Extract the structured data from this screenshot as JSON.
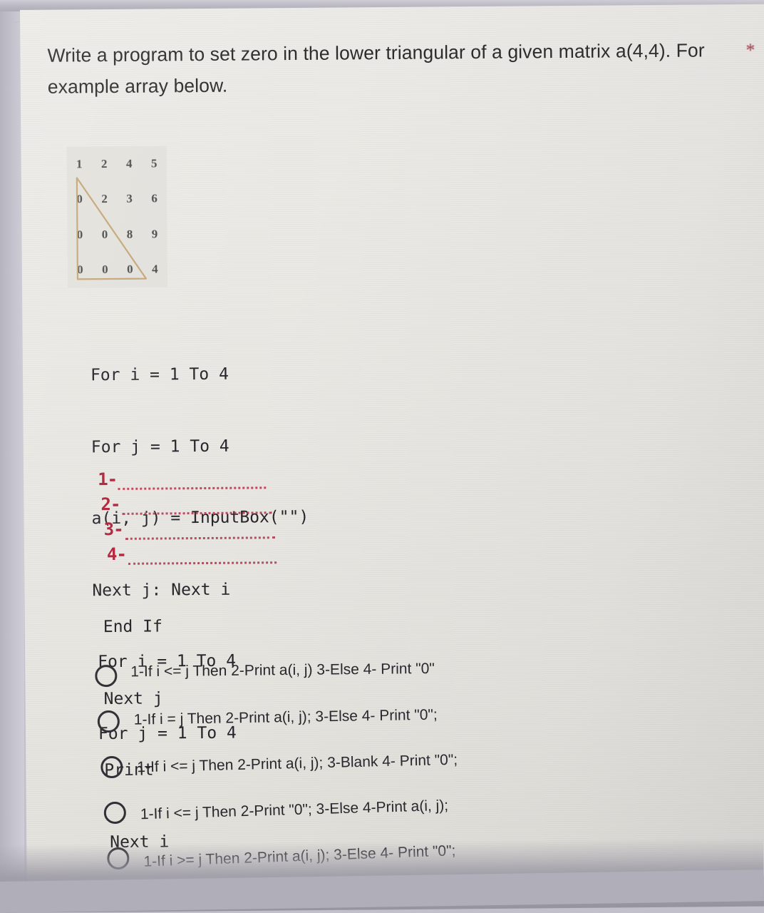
{
  "question": {
    "required_marker": "*",
    "prompt": "Write a program to set zero in the lower triangular of a given matrix a(4,4). For example array below."
  },
  "matrix_figure": {
    "name": "lower-triangular-matrix-example",
    "rows": [
      [
        "1",
        "2",
        "4",
        "5"
      ],
      [
        "0",
        "2",
        "3",
        "6"
      ],
      [
        "0",
        "0",
        "8",
        "9"
      ],
      [
        "0",
        "0",
        "0",
        "4"
      ]
    ],
    "overlay_shape": "triangle",
    "overlay_color": "#c0a072"
  },
  "code": {
    "lines_before_blanks": [
      {
        "text": "For i = 1 To 4",
        "indent": 0
      },
      {
        "text": "For j = 1 To 4",
        "indent": 0
      },
      {
        "text": "a(i, j) = InputBox(\"\")",
        "indent": 0
      },
      {
        "text": "Next j: Next i",
        "indent": 0
      },
      {
        "text": "For i = 1 To 4",
        "indent": 1
      },
      {
        "text": "For j = 1 To 4",
        "indent": 1
      }
    ],
    "blanks": [
      {
        "number": "1-"
      },
      {
        "number": "2-"
      },
      {
        "number": "3-"
      },
      {
        "number": "4-"
      }
    ],
    "lines_after_blanks": [
      {
        "text": "End If",
        "indent": 2
      },
      {
        "text": "Next j",
        "indent": 2
      },
      {
        "text": "Print",
        "indent": 2
      },
      {
        "text": "Next i",
        "indent": 3
      }
    ]
  },
  "options": [
    {
      "label": "1-If i <= j Then 2-Print a(i, j) 3-Else 4- Print \"0\"",
      "selected": false
    },
    {
      "label": "1-If i = j Then 2-Print a(i, j); 3-Else 4- Print \"0\";",
      "selected": false
    },
    {
      "label": "1-If i <= j Then 2-Print a(i, j); 3-Blank 4- Print \"0\";",
      "selected": false
    },
    {
      "label": "1-If i <= j Then 2-Print \"0\"; 3-Else 4-Print a(i, j);",
      "selected": false
    },
    {
      "label": "1-If i >= j Then 2-Print a(i, j); 3-Else 4- Print \"0\";",
      "selected": false
    }
  ],
  "colors": {
    "page_background": "#eae8e3",
    "bezel": "#c2c0ca",
    "text": "#26262c",
    "blank_red": "#b2223a",
    "required_star": "#a03242"
  }
}
